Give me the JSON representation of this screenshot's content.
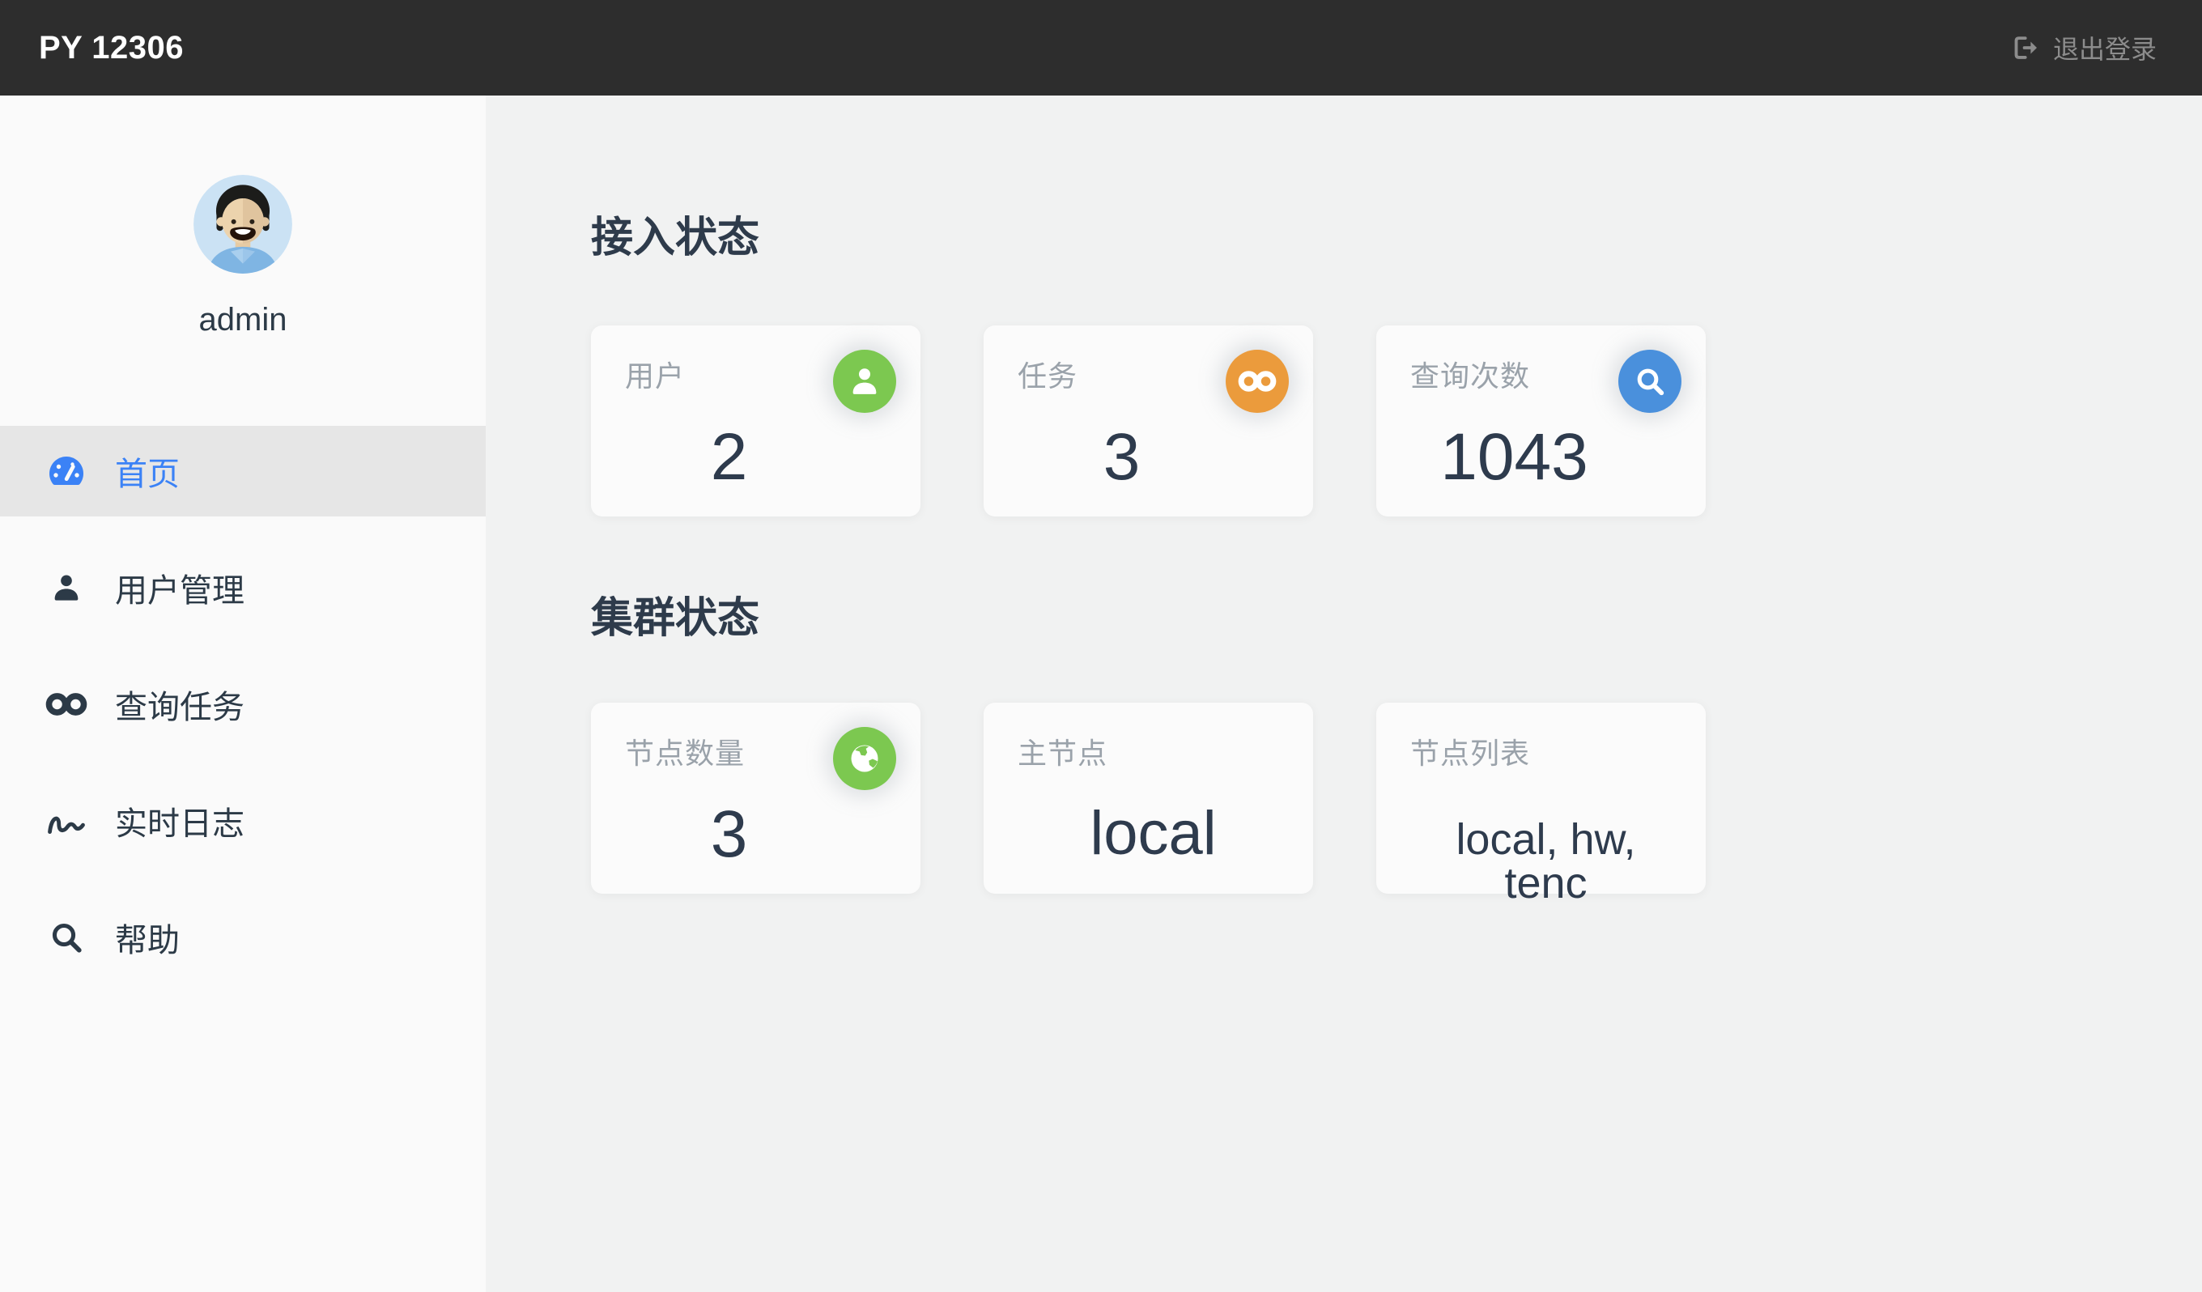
{
  "topbar": {
    "title": "PY 12306",
    "logout_label": "退出登录"
  },
  "sidebar": {
    "username": "admin",
    "active_item": "首页",
    "menu": [
      {
        "label": "首页",
        "icon": "dashboard-icon",
        "active": true
      },
      {
        "label": "用户管理",
        "icon": "user-icon",
        "active": false
      },
      {
        "label": "查询任务",
        "icon": "infinity-icon",
        "active": false
      },
      {
        "label": "实时日志",
        "icon": "signature-icon",
        "active": false
      },
      {
        "label": "帮助",
        "icon": "search-icon",
        "active": false
      }
    ]
  },
  "main": {
    "sections": [
      {
        "heading": "接入状态",
        "cards": [
          {
            "label": "用户",
            "value": "2",
            "icon": "user-icon",
            "icon_bg": "#7cc850"
          },
          {
            "label": "任务",
            "value": "3",
            "icon": "infinity-icon",
            "icon_bg": "#eb9b3c"
          },
          {
            "label": "查询次数",
            "value": "1043",
            "icon": "search-icon",
            "icon_bg": "#4a90dc"
          }
        ]
      },
      {
        "heading": "集群状态",
        "cards": [
          {
            "label": "节点数量",
            "value": "3",
            "icon": "globe-icon",
            "icon_bg": "#7cc850"
          },
          {
            "label": "主节点",
            "value": "local",
            "icon": null
          },
          {
            "label": "节点列表",
            "value": "local, hw, tenc",
            "icon": null
          }
        ]
      }
    ]
  },
  "colors": {
    "topbar_bg": "#2d2d2d",
    "sidebar_bg": "#fafafa",
    "main_bg": "#f1f2f2",
    "card_bg": "#fbfbfb",
    "active_item_bg": "#e6e6e6",
    "accent_blue": "#3b82f6",
    "stat_green": "#7cc850",
    "stat_orange": "#eb9b3c",
    "stat_blue": "#4a90dc",
    "dark_text": "#2e3b4b",
    "label_gray": "#9aa2aa",
    "logout_gray": "#8c8c8c"
  }
}
